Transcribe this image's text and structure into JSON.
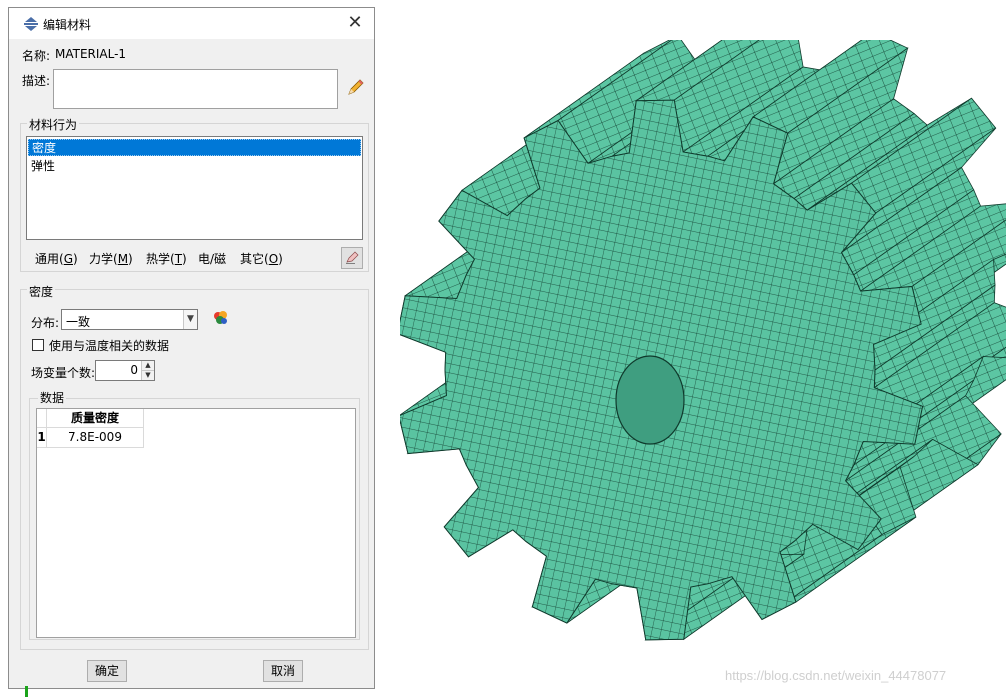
{
  "dialog": {
    "title": "编辑材料",
    "name_label": "名称:",
    "name_value": "MATERIAL-1",
    "description_label": "描述:",
    "description_value": "",
    "behaviors": {
      "group_title": "材料行为",
      "items": [
        "密度",
        "弹性"
      ],
      "selected_index": 0,
      "menus": [
        {
          "label": "通用(",
          "key": "G",
          "tail": ")"
        },
        {
          "label": "力学(",
          "key": "M",
          "tail": ")"
        },
        {
          "label": "热学(",
          "key": "T",
          "tail": ")"
        },
        {
          "label": "电/磁",
          "key": "",
          "tail": ""
        },
        {
          "label": "其它(",
          "key": "O",
          "tail": ")"
        }
      ]
    },
    "density": {
      "group_title": "密度",
      "distribution_label": "分布:",
      "distribution_value": "一致",
      "temp_checkbox_label": "使用与温度相关的数据",
      "temp_checked": false,
      "field_vars_label": "场变量个数:",
      "field_vars_value": "0",
      "data_group_title": "数据",
      "table": {
        "columns": [
          "质量密度"
        ],
        "rows": [
          {
            "index": "1",
            "values": [
              "7.8E-009"
            ]
          }
        ]
      }
    },
    "ok_label": "确定",
    "cancel_label": "取消"
  },
  "watermark": "https://blog.csdn.net/weixin_44478077",
  "colors": {
    "mesh_fill": "#5ac3a1",
    "mesh_line": "#0f3a2c",
    "selection": "#0078d7"
  }
}
